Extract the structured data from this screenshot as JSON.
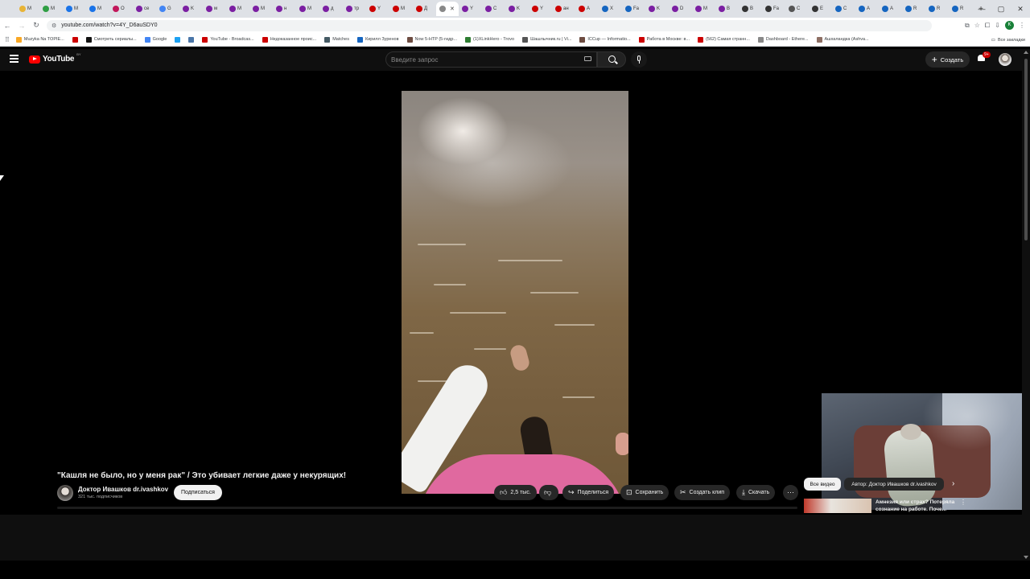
{
  "browser": {
    "tabs": [
      {
        "label": "M",
        "color": "#e8b436"
      },
      {
        "label": "M",
        "color": "#2f9e44"
      },
      {
        "label": "M",
        "color": "#1a73e8"
      },
      {
        "label": "M",
        "color": "#1a73e8"
      },
      {
        "label": "O",
        "color": "#c2185b"
      },
      {
        "label": "се",
        "color": "#7b1fa2"
      },
      {
        "label": "G",
        "color": "#4285f4"
      },
      {
        "label": "K",
        "color": "#7b1fa2"
      },
      {
        "label": "м",
        "color": "#7b1fa2"
      },
      {
        "label": "M",
        "color": "#7b1fa2"
      },
      {
        "label": "M",
        "color": "#7b1fa2"
      },
      {
        "label": "н",
        "color": "#7b1fa2"
      },
      {
        "label": "M",
        "color": "#7b1fa2"
      },
      {
        "label": "д",
        "color": "#7b1fa2"
      },
      {
        "label": "тр",
        "color": "#7b1fa2"
      },
      {
        "label": "Y",
        "color": "#cc0000"
      },
      {
        "label": "M",
        "color": "#cc0000"
      },
      {
        "label": "Д",
        "color": "#cc0000"
      },
      {
        "label": "",
        "color": "#888888",
        "active": true
      },
      {
        "label": "Y",
        "color": "#7b1fa2"
      },
      {
        "label": "С",
        "color": "#7b1fa2"
      },
      {
        "label": "K",
        "color": "#7b1fa2"
      },
      {
        "label": "Y",
        "color": "#cc0000"
      },
      {
        "label": "ан",
        "color": "#cc0000"
      },
      {
        "label": "A",
        "color": "#cc0000"
      },
      {
        "label": "X",
        "color": "#1565c0"
      },
      {
        "label": "Fa",
        "color": "#1565c0"
      },
      {
        "label": "K",
        "color": "#7b1fa2"
      },
      {
        "label": "D",
        "color": "#7b1fa2"
      },
      {
        "label": "M",
        "color": "#7b1fa2"
      },
      {
        "label": "B",
        "color": "#7b1fa2"
      },
      {
        "label": "B",
        "color": "#333333"
      },
      {
        "label": "Fa",
        "color": "#333333"
      },
      {
        "label": "C",
        "color": "#555555"
      },
      {
        "label": "E",
        "color": "#333333"
      },
      {
        "label": "C",
        "color": "#1565c0"
      },
      {
        "label": "A",
        "color": "#1565c0"
      },
      {
        "label": "A",
        "color": "#1565c0"
      },
      {
        "label": "R",
        "color": "#1565c0"
      },
      {
        "label": "R",
        "color": "#1565c0"
      },
      {
        "label": "R",
        "color": "#1565c0"
      }
    ],
    "url": "youtube.com/watch?v=4Y_D6auSDY0",
    "bookmarks": [
      {
        "label": "Muzyka Na TOPIE...",
        "color": "#f9a825"
      },
      {
        "label": "",
        "color": "#cc0000"
      },
      {
        "label": "Смотреть сериалы...",
        "color": "#111111"
      },
      {
        "label": "Google",
        "color": "#4285f4"
      },
      {
        "label": "",
        "color": "#1da1f2"
      },
      {
        "label": "",
        "color": "#4a76a8"
      },
      {
        "label": "YouTube - Broadcas...",
        "color": "#cc0000"
      },
      {
        "label": "Недоказанное проис...",
        "color": "#cc0000"
      },
      {
        "label": "Matches",
        "color": "#455a64"
      },
      {
        "label": "Кирилл Зуренов",
        "color": "#1565c0"
      },
      {
        "label": "Now 5-HTP (5-гидр...",
        "color": "#6d4c41"
      },
      {
        "label": "(1)XLinkHero - Trovo",
        "color": "#2e7d32"
      },
      {
        "label": "Шашлычник.ru | Vi...",
        "color": "#555555"
      },
      {
        "label": "ICCup — Informatio...",
        "color": "#6d4c41"
      },
      {
        "label": "Работа в Москве: в...",
        "color": "#cc0000"
      },
      {
        "label": "(562) Самая странн...",
        "color": "#cc0000"
      },
      {
        "label": "Dashboard - Ethere...",
        "color": "#888888"
      },
      {
        "label": "Ашхаландка (Ashva...",
        "color": "#8d6e63"
      }
    ],
    "all_bookmarks_label": "Все закладки",
    "profile_letter": "K"
  },
  "youtube": {
    "logo_text": "YouTube",
    "logo_country": "BY",
    "search_placeholder": "Введите запрос",
    "create_label": "Создать",
    "notifications_badge": "9+",
    "video": {
      "title": "\"Кашля не было, но у меня рак\" / Это убивает легкие даже у некурящих!",
      "channel_name": "Доктор Ивашков dr.ivashkov",
      "subscribers": "321 тыс. подписчиков",
      "subscribe_label": "Подписаться",
      "likes": "2,5 тыс.",
      "share_label": "Поделиться",
      "save_label": "Сохранить",
      "clip_label": "Создать клип",
      "download_label": "Скачать"
    },
    "related": {
      "chip_all": "Все видео",
      "chip_author": "Автор: Доктор Ивашков dr.ivashkov",
      "first_title": "Амнезия или страх? Потеряла сознание на работе. Поче..."
    }
  },
  "colors": {
    "yt_red": "#ff0000",
    "background": "#0f0f0f",
    "chip": "#272727"
  }
}
